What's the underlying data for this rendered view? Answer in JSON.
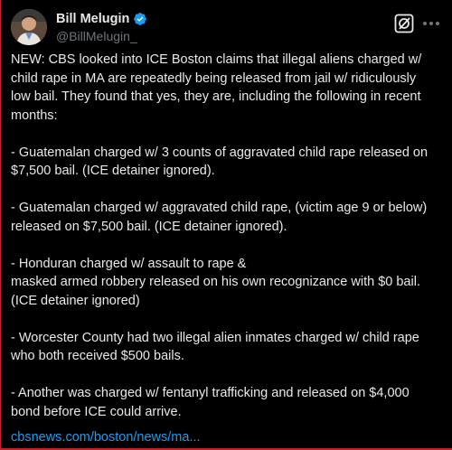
{
  "author": {
    "display_name": "Bill Melugin",
    "handle": "@BillMelugin_",
    "avatar_icon": "avatar-photo",
    "verified_icon": "verified-badge-icon",
    "verified_color": "#1d9bf0"
  },
  "toolbar": {
    "grok_icon": "grok-icon",
    "more_icon": "more-options-icon"
  },
  "tweet": {
    "paragraphs": [
      "NEW: CBS looked into ICE Boston claims that illegal aliens charged w/ child rape in MA are repeatedly being released from jail w/ ridiculously low bail. They found that yes, they are, including the following in recent months:",
      "- Guatemalan charged w/ 3 counts of aggravated child rape released on $7,500 bail. (ICE detainer ignored).",
      "- Guatemalan charged w/ aggravated child rape, (victim age 9 or below) released on $7,500 bail. (ICE detainer ignored).",
      "- Honduran charged w/ assault to rape &",
      "masked armed robbery released on his own recognizance with $0 bail. (ICE detainer ignored)",
      "- Worcester County had two illegal alien inmates charged w/ child rape who both received $500 bails.",
      "- Another was charged w/ fentanyl trafficking and released on $4,000 bond before ICE could arrive."
    ],
    "link_text": "cbsnews.com/boston/news/ma..."
  },
  "colors": {
    "background": "#000000",
    "text": "#e7e9ea",
    "secondary_text": "#71767b",
    "link": "#1d9bf0"
  }
}
